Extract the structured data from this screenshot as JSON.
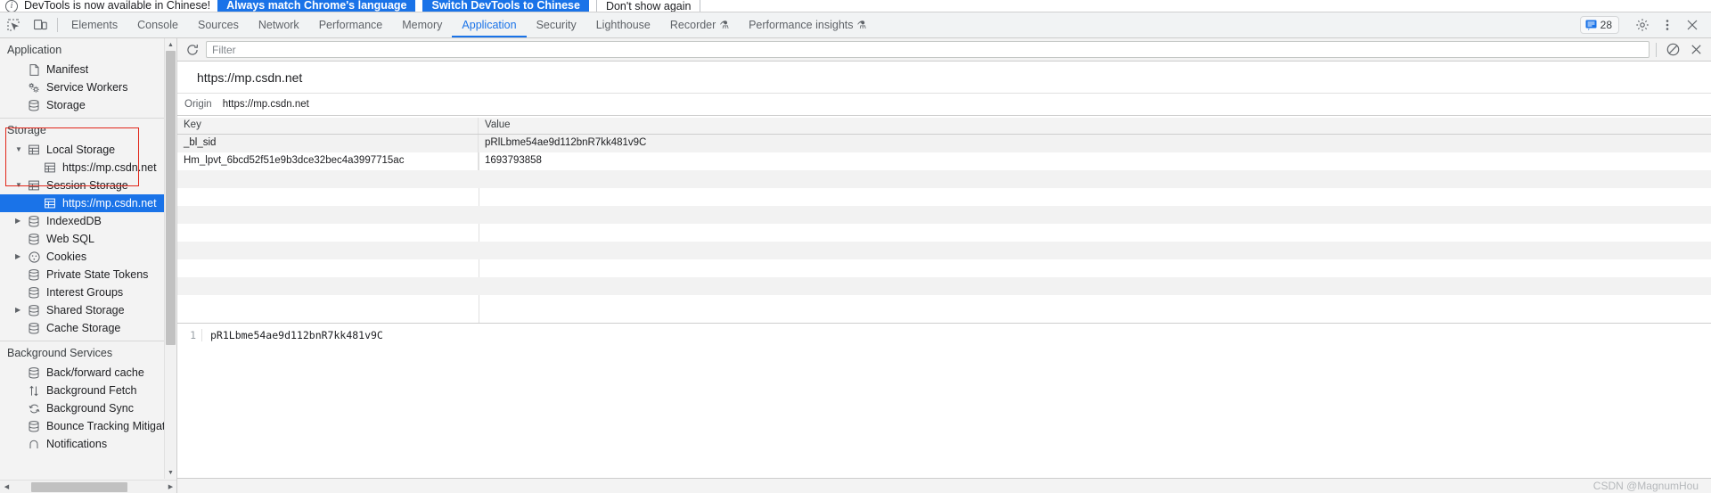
{
  "banner": {
    "icon": "info-icon",
    "message": "DevTools is now available in Chinese!",
    "primary_button": "Always match Chrome's language",
    "secondary_button": "Switch DevTools to Chinese",
    "dismiss_button": "Don't show again",
    "accent_color": "#1a73e8"
  },
  "tabbar": {
    "inspect_icon": "inspect-element-icon",
    "device_icon": "device-toolbar-icon",
    "tabs": [
      {
        "label": "Elements",
        "active": false,
        "flask": false
      },
      {
        "label": "Console",
        "active": false,
        "flask": false
      },
      {
        "label": "Sources",
        "active": false,
        "flask": false
      },
      {
        "label": "Network",
        "active": false,
        "flask": false
      },
      {
        "label": "Performance",
        "active": false,
        "flask": false
      },
      {
        "label": "Memory",
        "active": false,
        "flask": false
      },
      {
        "label": "Application",
        "active": true,
        "flask": false
      },
      {
        "label": "Security",
        "active": false,
        "flask": false
      },
      {
        "label": "Lighthouse",
        "active": false,
        "flask": false
      },
      {
        "label": "Recorder",
        "active": false,
        "flask": true
      },
      {
        "label": "Performance insights",
        "active": false,
        "flask": true
      }
    ],
    "message_count": "28",
    "settings_icon": "gear-icon",
    "more_icon": "kebab-menu-icon",
    "close_icon": "close-icon"
  },
  "sidebar": {
    "sections": [
      {
        "title": "Application",
        "items": [
          {
            "label": "Manifest",
            "icon": "document-icon",
            "level": 1,
            "twisty": "",
            "selected": false
          },
          {
            "label": "Service Workers",
            "icon": "gears-icon",
            "level": 1,
            "twisty": "",
            "selected": false
          },
          {
            "label": "Storage",
            "icon": "database-icon",
            "level": 1,
            "twisty": "",
            "selected": false
          }
        ]
      },
      {
        "title": "Storage",
        "items": [
          {
            "label": "Local Storage",
            "icon": "table-icon",
            "level": 1,
            "twisty": "▼",
            "selected": false
          },
          {
            "label": "https://mp.csdn.net",
            "icon": "table-icon",
            "level": 2,
            "twisty": "",
            "selected": false
          },
          {
            "label": "Session Storage",
            "icon": "table-icon",
            "level": 1,
            "twisty": "▼",
            "selected": false
          },
          {
            "label": "https://mp.csdn.net",
            "icon": "table-icon",
            "level": 2,
            "twisty": "",
            "selected": true
          },
          {
            "label": "IndexedDB",
            "icon": "database-icon",
            "level": 1,
            "twisty": "▶",
            "selected": false
          },
          {
            "label": "Web SQL",
            "icon": "database-icon",
            "level": 1,
            "twisty": "",
            "selected": false
          },
          {
            "label": "Cookies",
            "icon": "cookie-icon",
            "level": 1,
            "twisty": "▶",
            "selected": false
          },
          {
            "label": "Private State Tokens",
            "icon": "database-icon",
            "level": 1,
            "twisty": "",
            "selected": false
          },
          {
            "label": "Interest Groups",
            "icon": "database-icon",
            "level": 1,
            "twisty": "",
            "selected": false
          },
          {
            "label": "Shared Storage",
            "icon": "database-icon",
            "level": 1,
            "twisty": "▶",
            "selected": false
          },
          {
            "label": "Cache Storage",
            "icon": "database-icon",
            "level": 1,
            "twisty": "",
            "selected": false
          }
        ]
      },
      {
        "title": "Background Services",
        "items": [
          {
            "label": "Back/forward cache",
            "icon": "database-icon",
            "level": 1,
            "twisty": "",
            "selected": false
          },
          {
            "label": "Background Fetch",
            "icon": "arrows-updown-icon",
            "level": 1,
            "twisty": "",
            "selected": false
          },
          {
            "label": "Background Sync",
            "icon": "sync-icon",
            "level": 1,
            "twisty": "",
            "selected": false
          },
          {
            "label": "Bounce Tracking Mitigatio",
            "icon": "database-icon",
            "level": 1,
            "twisty": "",
            "selected": false
          },
          {
            "label": "Notifications",
            "icon": "bell-icon",
            "level": 1,
            "twisty": "",
            "selected": false
          }
        ]
      }
    ],
    "annotation_color": "#e2271a",
    "selected_color": "#1a73e8"
  },
  "toolbar": {
    "refresh_icon": "refresh-icon",
    "filter_placeholder": "Filter",
    "filter_value": "",
    "clear_icon": "clear-icon",
    "delete_icon": "delete-icon"
  },
  "content": {
    "title": "https://mp.csdn.net",
    "origin_label": "Origin",
    "origin_value": "https://mp.csdn.net"
  },
  "table": {
    "columns": [
      "Key",
      "Value"
    ],
    "rows": [
      {
        "key": "_bl_sid",
        "value": "pRlLbme54ae9d112bnR7kk481v9C"
      },
      {
        "key": "Hm_lpvt_6bcd52f51e9b3dce32bec4a3997715ac",
        "value": "1693793858"
      }
    ]
  },
  "preview": {
    "line_number": "1",
    "code": "pR1Lbme54ae9d112bnR7kk481v9C"
  },
  "statusbar": {
    "watermark": "CSDN @MagnumHou"
  }
}
